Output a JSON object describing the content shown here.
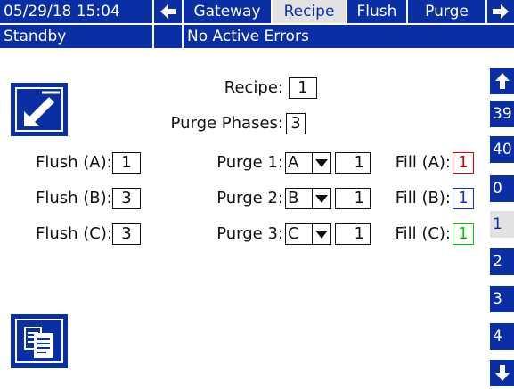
{
  "header": {
    "datetime": "05/29/18 15:04",
    "tabs": [
      "Gateway",
      "Recipe",
      "Flush",
      "Purge"
    ],
    "status": "Standby",
    "errors": "No Active Errors"
  },
  "main": {
    "recipe_label": "Recipe:",
    "recipe_value": "1",
    "purge_phases_label": "Purge Phases:",
    "purge_phases_value": "3",
    "flush": [
      {
        "label": "Flush (A):",
        "value": "1"
      },
      {
        "label": "Flush (B):",
        "value": "3"
      },
      {
        "label": "Flush (C):",
        "value": "3"
      }
    ],
    "purge": [
      {
        "label": "Purge 1:",
        "select": "A",
        "value": "1"
      },
      {
        "label": "Purge 2:",
        "select": "B",
        "value": "1"
      },
      {
        "label": "Purge 3:",
        "select": "C",
        "value": "1"
      }
    ],
    "fill": [
      {
        "label": "Fill (A):",
        "value": "1",
        "color": "#e00000"
      },
      {
        "label": "Fill (B):",
        "value": "1",
        "color": "#1a2bd8"
      },
      {
        "label": "Fill (C):",
        "value": "1",
        "color": "#00cc00"
      }
    ]
  },
  "sidebar": {
    "items": [
      "39",
      "40",
      "0",
      "1",
      "2",
      "3",
      "4"
    ],
    "active": "1"
  },
  "colors": {
    "primary": "#0a2fa4",
    "active_tab": "#e2e2e2"
  },
  "icons": [
    "arrow-left-icon",
    "arrow-right-icon",
    "arrow-up-icon",
    "arrow-down-icon",
    "edit-icon",
    "copy-icon"
  ]
}
